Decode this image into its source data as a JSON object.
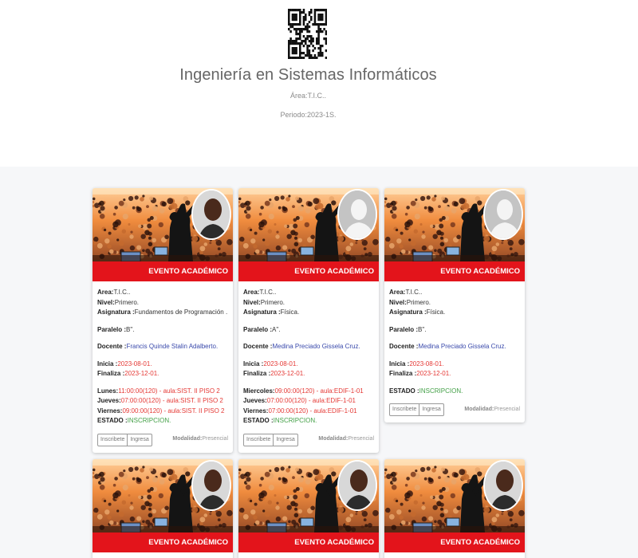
{
  "header": {
    "title": "Ingeniería en Sistemas Informáticos",
    "area": "Área:T.I.C..",
    "periodo": "Periodo:2023-1S."
  },
  "labels": {
    "area": "Area:",
    "nivel": "Nivel:",
    "asignatura": "Asignatura :",
    "paralelo": "Paralelo :",
    "docente": "Docente :",
    "inicia": "Inicia :",
    "finaliza": "Finaliza :",
    "estado": "ESTADO :",
    "modalidad": "Modalidad:",
    "banner": "EVENTO ACADÉMICO",
    "btn_inscribete": "Inscribete",
    "btn_ingresa": "Ingresa"
  },
  "cards": [
    {
      "area": "T.I.C..",
      "nivel": "Primero.",
      "asignatura": "Fundamentos de Programación .",
      "paralelo": "B\".",
      "docente": "Francis Quinde Stalin Adalberto.",
      "inicia": "2023-08-01.",
      "finaliza": "2023-12-01.",
      "horario": [
        {
          "day": "Lunes:",
          "text": "11:00:00(120) - aula:SIST. II PISO 2"
        },
        {
          "day": "Jueves:",
          "text": "07:00:00(120) - aula:SIST. II PISO 2"
        },
        {
          "day": "Viernes:",
          "text": "09:00:00(120) - aula:SIST. II PISO 2"
        }
      ],
      "estado": "INSCRIPCION.",
      "modalidad": "Presencial",
      "avatar": "photo"
    },
    {
      "area": "T.I.C..",
      "nivel": "Primero.",
      "asignatura": "Física.",
      "paralelo": "A\".",
      "docente": "Medina Preciado Gissela Cruz.",
      "inicia": "2023-08-01.",
      "finaliza": "2023-12-01.",
      "horario": [
        {
          "day": "Miercoles:",
          "text": "09:00:00(120) - aula:EDIF-1-01"
        },
        {
          "day": "Jueves:",
          "text": "07:00:00(120) - aula:EDIF-1-01"
        },
        {
          "day": "Viernes:",
          "text": "07:00:00(120) - aula:EDIF-1-01"
        }
      ],
      "estado": "INSCRIPCION.",
      "modalidad": "Presencial",
      "avatar": "placeholder"
    },
    {
      "area": "T.I.C..",
      "nivel": "Primero.",
      "asignatura": "Física.",
      "paralelo": "B\".",
      "docente": "Medina Preciado Gissela Cruz.",
      "inicia": "2023-08-01.",
      "finaliza": "2023-12-01.",
      "horario": [],
      "estado": "INSCRIPCION.",
      "modalidad": "Presencial",
      "avatar": "placeholder"
    }
  ],
  "bottom_cards": [
    {
      "avatar": "photo"
    },
    {
      "avatar": "photo"
    },
    {
      "avatar": "photo"
    }
  ],
  "colors": {
    "banner_red": "#e3141b",
    "date_red": "#e53935",
    "docente_blue": "#3949ab",
    "estado_green": "#43a047",
    "section_gray": "#f6f7f9"
  }
}
